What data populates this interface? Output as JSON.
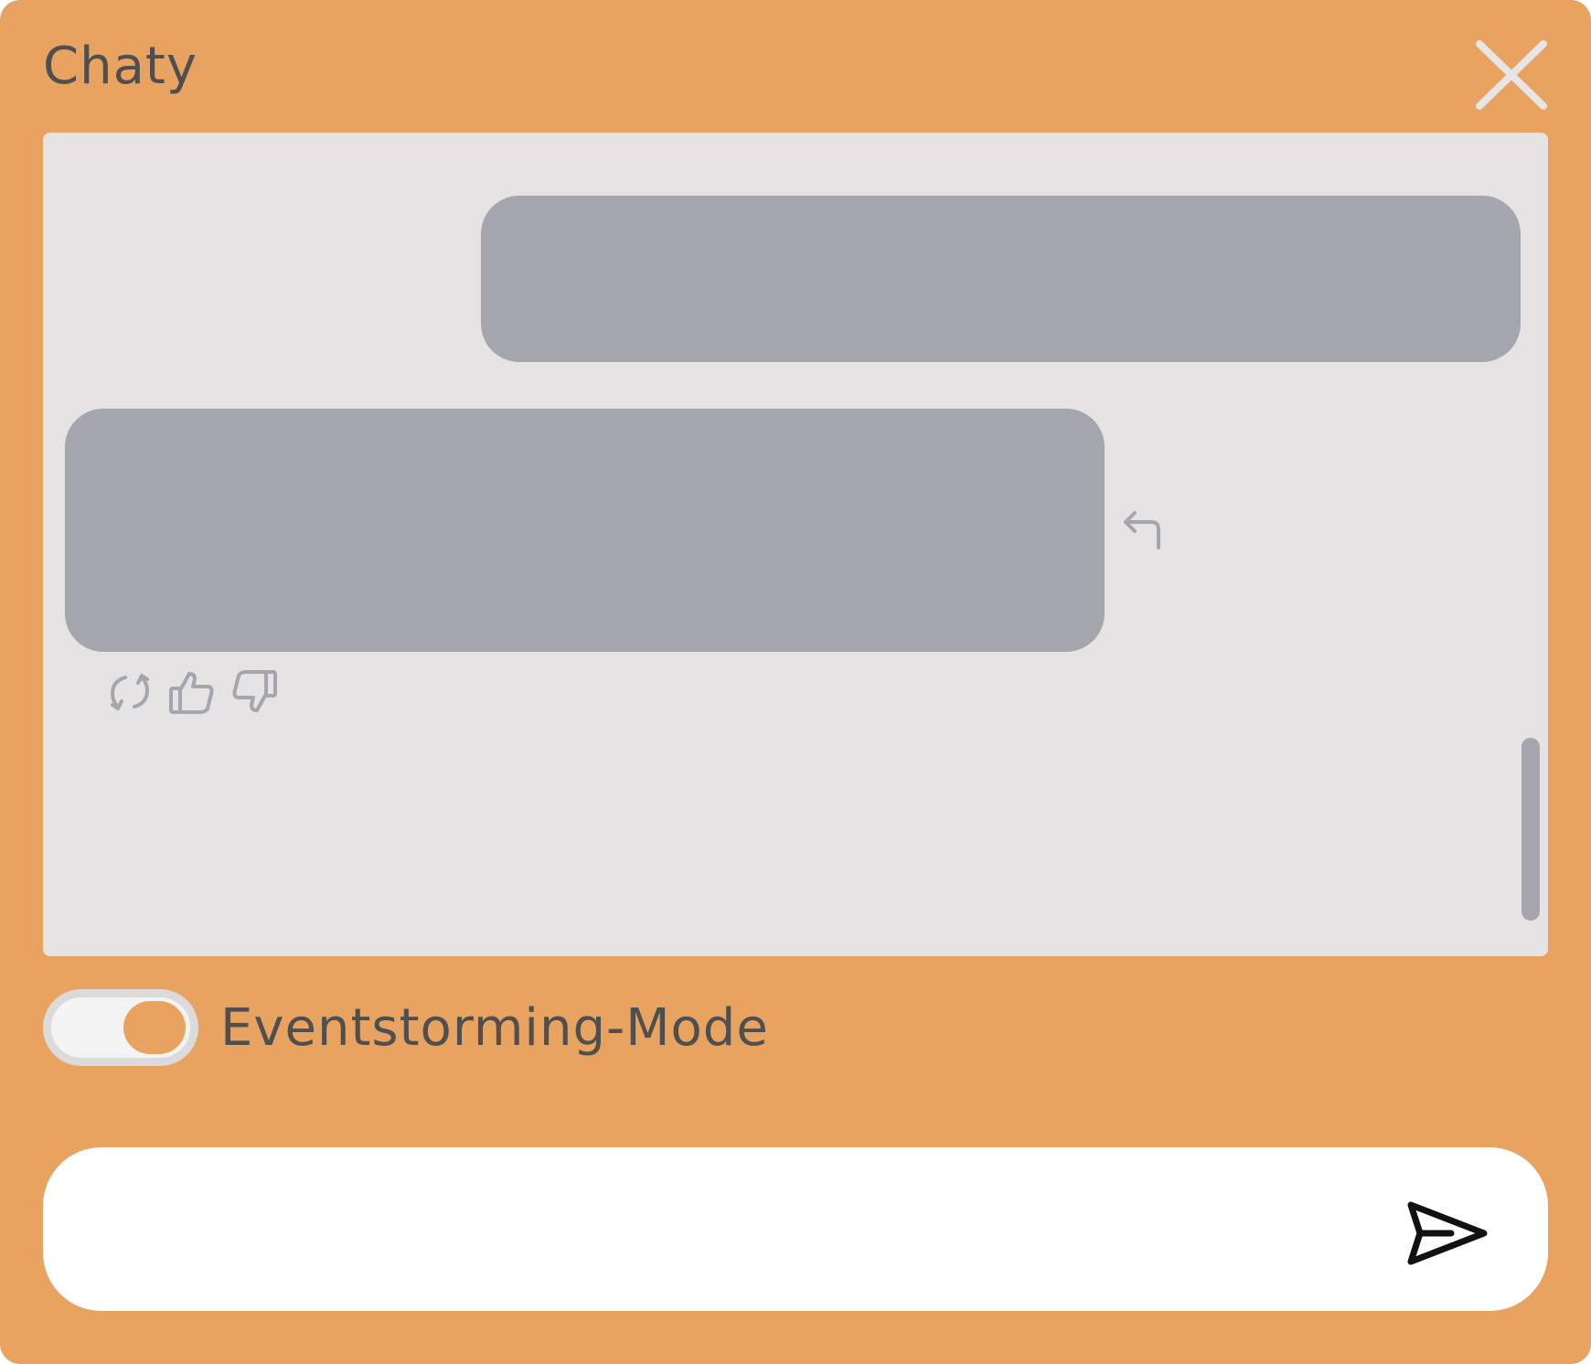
{
  "header": {
    "title": "Chaty",
    "close_icon": "close-icon"
  },
  "messages": [
    {
      "role": "user",
      "text": ""
    },
    {
      "role": "assistant",
      "text": ""
    }
  ],
  "message_actions": {
    "reply_icon": "reply-arrow-icon",
    "regenerate_icon": "regenerate-icon",
    "like_icon": "thumbs-up-icon",
    "dislike_icon": "thumbs-down-icon"
  },
  "mode_toggle": {
    "label": "Eventstorming-Mode",
    "enabled": true
  },
  "composer": {
    "value": "",
    "placeholder": "",
    "send_icon": "send-icon"
  },
  "colors": {
    "panel_bg": "#E9A360",
    "chat_bg": "#E5E3E4",
    "bubble_bg": "#A5A5AD",
    "text": "#4F4F4F",
    "icon_gray": "#A5A5AD"
  }
}
